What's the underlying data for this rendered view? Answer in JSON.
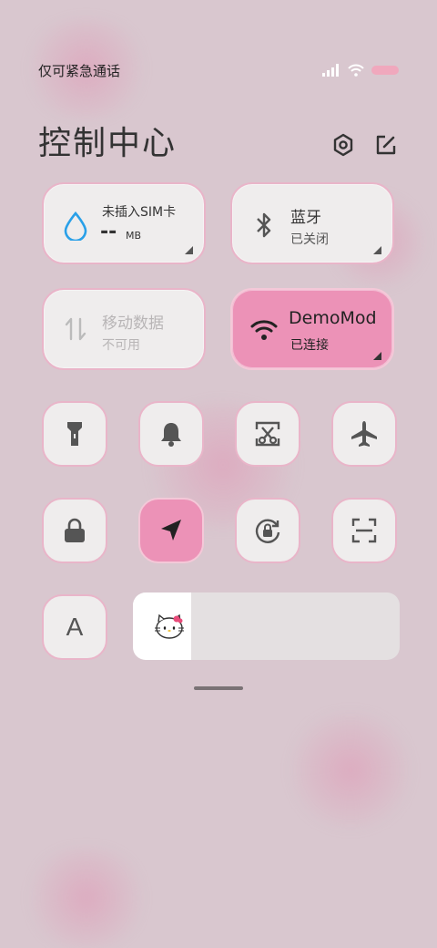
{
  "status": {
    "carrier_text": "仅可紧急通话"
  },
  "header": {
    "title": "控制中心"
  },
  "tiles": {
    "data_usage": {
      "label": "未插入SIM卡",
      "value": "--",
      "unit": "MB"
    },
    "bluetooth": {
      "label": "蓝牙",
      "status": "已关闭"
    },
    "mobile_data": {
      "label": "移动数据",
      "status": "不可用"
    },
    "wifi": {
      "label": "DemoMod",
      "status": "已连接"
    }
  },
  "toggles": [
    {
      "icon": "flashlight-icon",
      "active": false
    },
    {
      "icon": "bell-icon",
      "active": false
    },
    {
      "icon": "screenshot-icon",
      "active": false
    },
    {
      "icon": "airplane-icon",
      "active": false
    },
    {
      "icon": "lock-icon",
      "active": false
    },
    {
      "icon": "location-icon",
      "active": true
    },
    {
      "icon": "rotation-lock-icon",
      "active": false
    },
    {
      "icon": "scan-icon",
      "active": false
    }
  ],
  "font_button": {
    "label": "A"
  },
  "brightness": {
    "level": 0.22
  },
  "colors": {
    "accent_pink": "#ec92b7",
    "tile_bg": "#efeded",
    "background": "#d9c7cf"
  }
}
